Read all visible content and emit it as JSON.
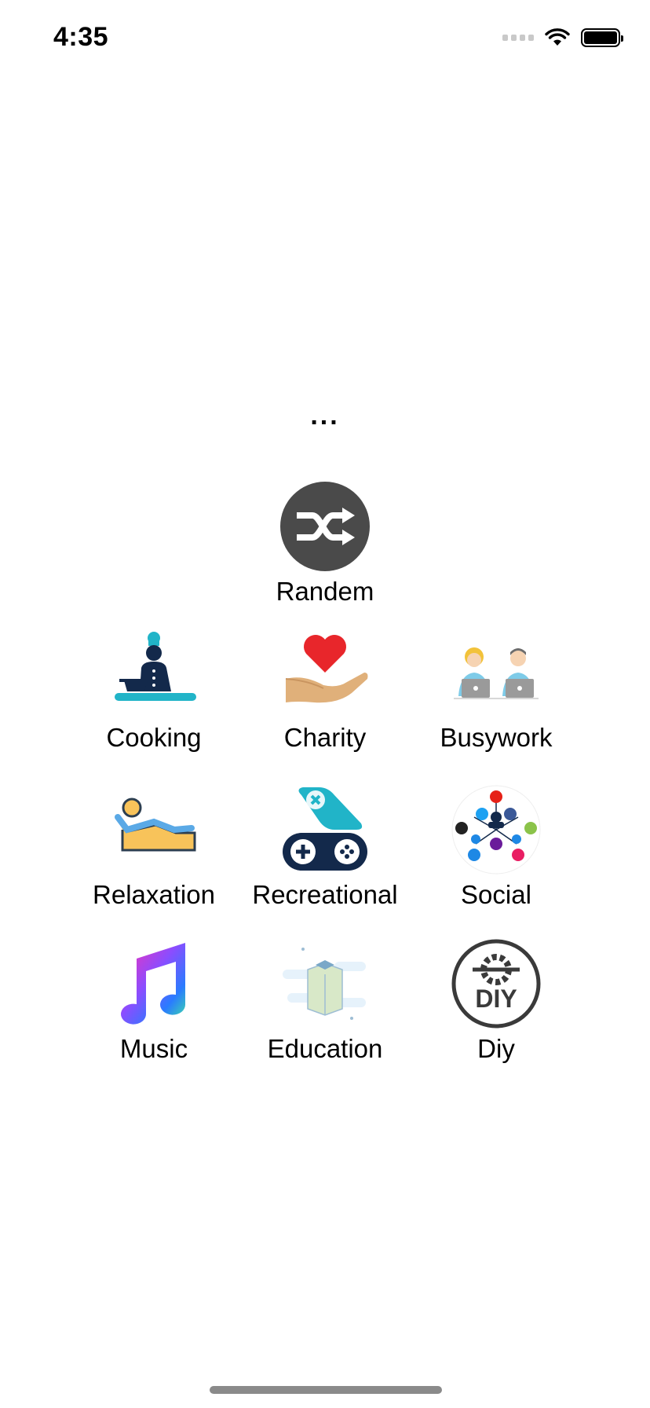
{
  "status_bar": {
    "time": "4:35"
  },
  "loading_indicator": "...",
  "random": {
    "label": "Randem",
    "icon": "shuffle-icon"
  },
  "categories": [
    {
      "label": "Cooking",
      "icon": "chef-icon"
    },
    {
      "label": "Charity",
      "icon": "heart-hand-icon"
    },
    {
      "label": "Busywork",
      "icon": "office-workers-icon"
    },
    {
      "label": "Relaxation",
      "icon": "reclining-person-icon"
    },
    {
      "label": "Recreational",
      "icon": "gamepad-icon"
    },
    {
      "label": "Social",
      "icon": "social-network-icon"
    },
    {
      "label": "Music",
      "icon": "music-note-icon"
    },
    {
      "label": "Education",
      "icon": "education-box-icon"
    },
    {
      "label": "Diy",
      "icon": "diy-gear-icon"
    }
  ],
  "colors": {
    "random_bg": "#4a4a4a",
    "cook_blue": "#13294b",
    "cook_teal": "#21b4c8",
    "heart_red": "#e8262b",
    "hand_tan": "#e0b07a"
  }
}
